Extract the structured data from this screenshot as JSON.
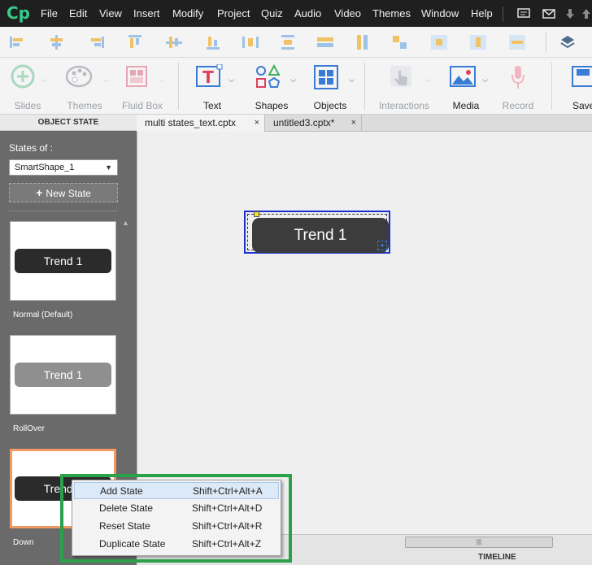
{
  "app": {
    "logo": "Cp"
  },
  "menu": [
    "File",
    "Edit",
    "View",
    "Insert",
    "Modify",
    "Project",
    "Quiz",
    "Audio",
    "Video",
    "Themes",
    "Window",
    "Help"
  ],
  "toolbar": {
    "tools": [
      {
        "label": "Slides",
        "enabled": false
      },
      {
        "label": "Themes",
        "enabled": false
      },
      {
        "label": "Fluid Box",
        "enabled": false
      },
      {
        "label": "Text",
        "enabled": true
      },
      {
        "label": "Shapes",
        "enabled": true
      },
      {
        "label": "Objects",
        "enabled": true
      },
      {
        "label": "Interactions",
        "enabled": false
      },
      {
        "label": "Media",
        "enabled": true
      },
      {
        "label": "Record",
        "enabled": false
      },
      {
        "label": "Save",
        "enabled": true
      }
    ]
  },
  "panel": {
    "title": "OBJECT STATE",
    "states_of_label": "States of :",
    "selected_object": "SmartShape_1",
    "new_state_label": "New State",
    "states": [
      {
        "button_text": "Trend 1",
        "label": "Normal (Default)",
        "color": "#2b2b2b"
      },
      {
        "button_text": "Trend 1",
        "label": "RollOver",
        "color": "#8f8f8f"
      },
      {
        "button_text": "Trend 1",
        "label": "Down",
        "color": "#2b2b2b"
      }
    ]
  },
  "tabs": [
    {
      "label": "multi states_text.cptx",
      "close": "×"
    },
    {
      "label": "untitled3.cptx*",
      "close": "×"
    }
  ],
  "stage": {
    "button_text": "Trend 1"
  },
  "context_menu": {
    "items": [
      {
        "name": "Add State",
        "shortcut": "Shift+Ctrl+Alt+A"
      },
      {
        "name": "Delete State",
        "shortcut": "Shift+Ctrl+Alt+D"
      },
      {
        "name": "Reset State",
        "shortcut": "Shift+Ctrl+Alt+R"
      },
      {
        "name": "Duplicate State",
        "shortcut": "Shift+Ctrl+Alt+Z"
      }
    ]
  },
  "bottom": {
    "timeline_label": "TIMELINE"
  },
  "colors": {
    "highlight_frame": "#2aa24a",
    "selected_state_border": "#f29a64",
    "selection_box": "#1a2fd0"
  }
}
